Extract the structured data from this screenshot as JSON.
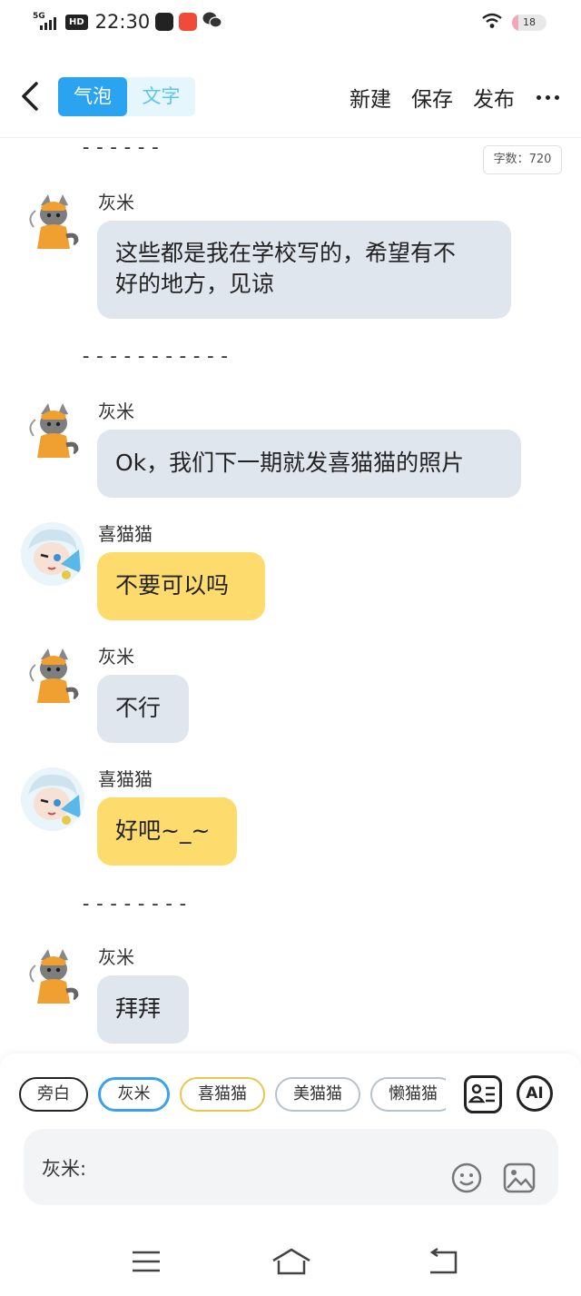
{
  "status_bar": {
    "network": "5G",
    "hd_label": "HD",
    "time": "22:30",
    "battery": "18",
    "battery_level": 0.18
  },
  "header": {
    "tab_bubble": "气泡",
    "tab_text": "文字",
    "new_label": "新建",
    "save_label": "保存",
    "publish_label": "发布"
  },
  "word_count": "字数：720",
  "dividers": [
    "------",
    "-----------",
    "--------"
  ],
  "messages": [
    {
      "name": "灰米",
      "text_line1": "这些都是我在学校写的，希望有不",
      "text_line2": "好的地方，见谅"
    },
    {
      "name": "灰米",
      "text": "Ok，我们下一期就发喜猫猫的照片"
    },
    {
      "name": "喜猫猫",
      "text": "不要可以吗"
    },
    {
      "name": "灰米",
      "text": "不行"
    },
    {
      "name": "喜猫猫",
      "text": "好吧~_~"
    },
    {
      "name": "灰米",
      "text": "拜拜"
    }
  ],
  "characters": [
    "旁白",
    "灰米",
    "喜猫猫",
    "美猫猫",
    "懒猫猫"
  ],
  "ai_label": "AI",
  "input": {
    "value": "灰米:"
  },
  "colors": {
    "accent": "#2aa3f0",
    "bubble_grey": "#e0e6ee",
    "bubble_yellow": "#fddb6d"
  },
  "icons": [
    "back-chevron-icon",
    "more-dots-icon",
    "character-card-icon",
    "emoji-icon",
    "image-icon",
    "menu-icon",
    "home-icon",
    "return-icon"
  ]
}
